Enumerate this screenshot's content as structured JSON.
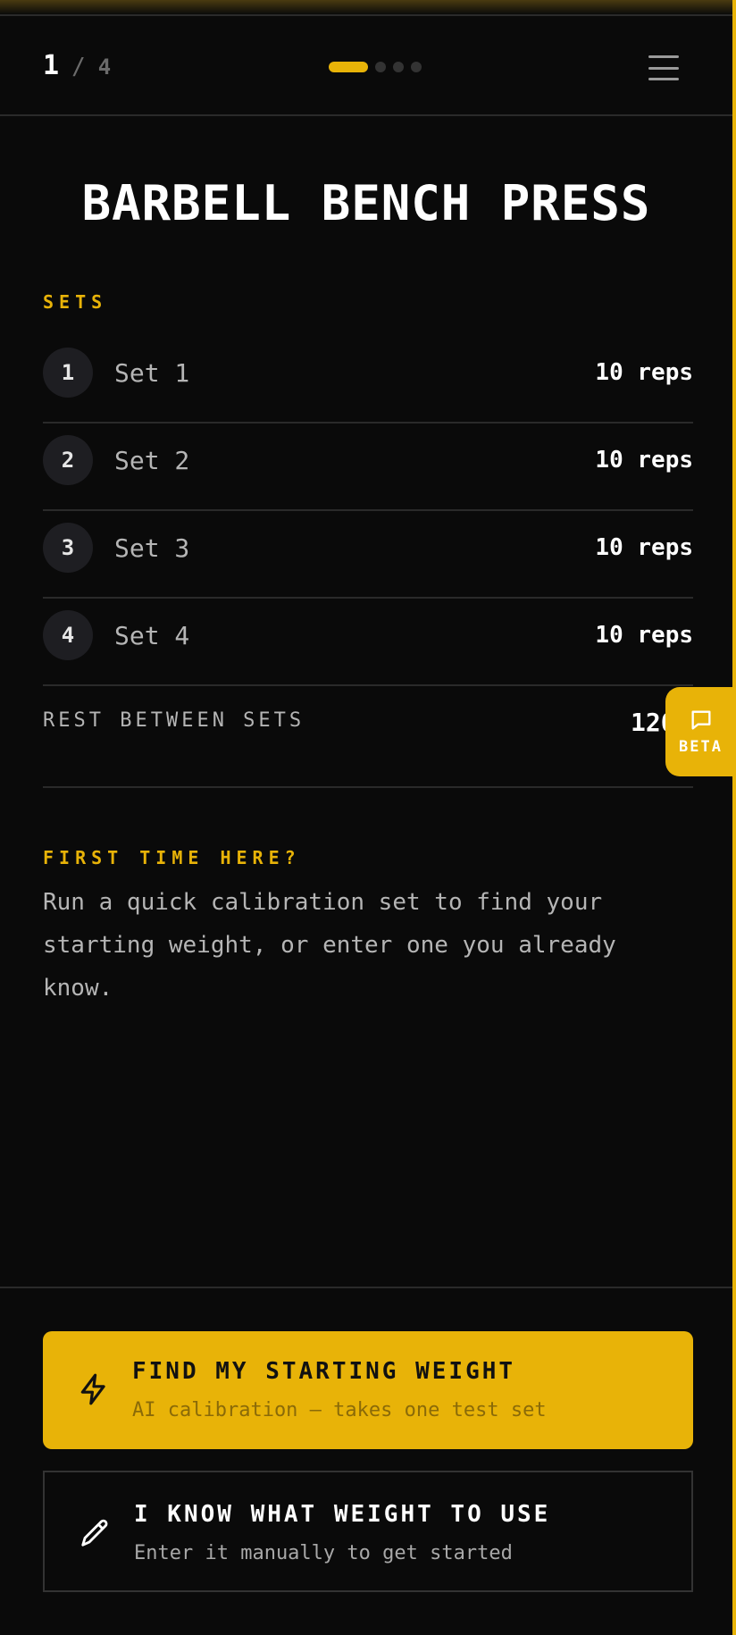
{
  "header": {
    "current": "1",
    "separator": "/",
    "total": "4",
    "progress": {
      "steps": 4,
      "active_step": 1
    },
    "menu_icon": "hamburger-menu-icon"
  },
  "exercise": {
    "title": "BARBELL BENCH PRESS"
  },
  "sets_section": {
    "label": "SETS",
    "sets": [
      {
        "number": "1",
        "name": "Set 1",
        "reps": "10 reps"
      },
      {
        "number": "2",
        "name": "Set 2",
        "reps": "10 reps"
      },
      {
        "number": "3",
        "name": "Set 3",
        "reps": "10 reps"
      },
      {
        "number": "4",
        "name": "Set 4",
        "reps": "10 reps"
      }
    ]
  },
  "rest": {
    "label": "REST BETWEEN SETS",
    "value": "120"
  },
  "beta_button": {
    "label": "BETA",
    "icon": "chat-bubble-icon"
  },
  "first_time": {
    "label": "FIRST TIME HERE?",
    "description": "Run a quick calibration set to find your starting weight, or enter one you already know."
  },
  "actions": {
    "calibrate": {
      "title": "FIND MY STARTING WEIGHT",
      "subtitle": "AI calibration — takes one test set",
      "icon": "lightning-bolt-icon"
    },
    "manual": {
      "title": "I KNOW WHAT WEIGHT TO USE",
      "subtitle": "Enter it manually to get started",
      "icon": "pencil-icon"
    }
  },
  "colors": {
    "accent": "#e8b308",
    "background": "#0a0a0a",
    "divider": "#2a2a2a",
    "muted_text": "#b5b5b5"
  }
}
